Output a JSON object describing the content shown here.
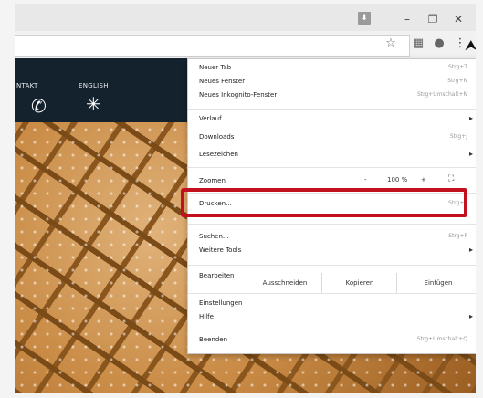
{
  "window": {
    "extension_label": "⬇",
    "minimize": "–",
    "restore": "❐",
    "close": "✕"
  },
  "toolbar": {
    "star_icon": "star-icon",
    "menu_icon": "kebab-menu-icon"
  },
  "site": {
    "nav": [
      {
        "label": "NTAKT",
        "icon": "phone-icon"
      },
      {
        "label": "ENGLISH",
        "icon": "union-jack-icon"
      }
    ]
  },
  "menu": {
    "items": [
      {
        "label": "Neuer Tab",
        "shortcut": "Strg+T"
      },
      {
        "label": "Neues Fenster",
        "shortcut": "Strg+N"
      },
      {
        "label": "Neues Inkognito-Fenster",
        "shortcut": "Strg+Umschalt+N"
      },
      {
        "label": "Verlauf",
        "shortcut": ""
      },
      {
        "label": "Downloads",
        "shortcut": "Strg+J"
      },
      {
        "label": "Lesezeichen",
        "shortcut": ""
      },
      {
        "label": "Zoomen",
        "shortcut": ""
      },
      {
        "label": "Drucken...",
        "shortcut": "Strg+P"
      },
      {
        "label": "Suchen...",
        "shortcut": "Strg+F"
      },
      {
        "label": "Weitere Tools",
        "shortcut": ""
      },
      {
        "label": "Bearbeiten",
        "shortcut": ""
      },
      {
        "label": "Einstellungen",
        "shortcut": ""
      },
      {
        "label": "Hilfe",
        "shortcut": ""
      },
      {
        "label": "Beenden",
        "shortcut": "Strg+Umschalt+Q"
      }
    ],
    "zoom": {
      "minus": "-",
      "value": "100 %",
      "plus": "+",
      "fullscreen": "⛶"
    },
    "edit": {
      "cut": "Ausschneiden",
      "copy": "Kopieren",
      "paste": "Einfügen"
    }
  },
  "colors": {
    "highlight": "#c2101e",
    "nav_bg": "#14222e"
  }
}
